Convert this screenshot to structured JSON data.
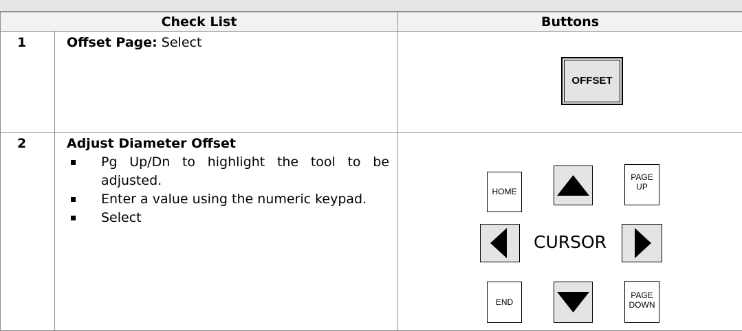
{
  "headers": {
    "checklist": "Check List",
    "buttons": "Buttons"
  },
  "rows": [
    {
      "num": "1",
      "label": "Offset Page:",
      "text": " Select"
    },
    {
      "num": "2",
      "title": "Adjust Diameter Offset",
      "bullets": [
        "Pg Up/Dn to highlight the tool to be adjusted.",
        "Enter a value using the numeric keypad.",
        "Select"
      ]
    }
  ],
  "keys": {
    "offset": "OFFSET",
    "home": "HOME",
    "page_up": [
      "PAGE",
      "UP"
    ],
    "cursor": "CURSOR",
    "end": "END",
    "page_down": [
      "PAGE",
      "DOWN"
    ]
  },
  "icons": [
    "arrow-up-icon",
    "arrow-left-icon",
    "arrow-right-icon",
    "arrow-down-icon"
  ]
}
